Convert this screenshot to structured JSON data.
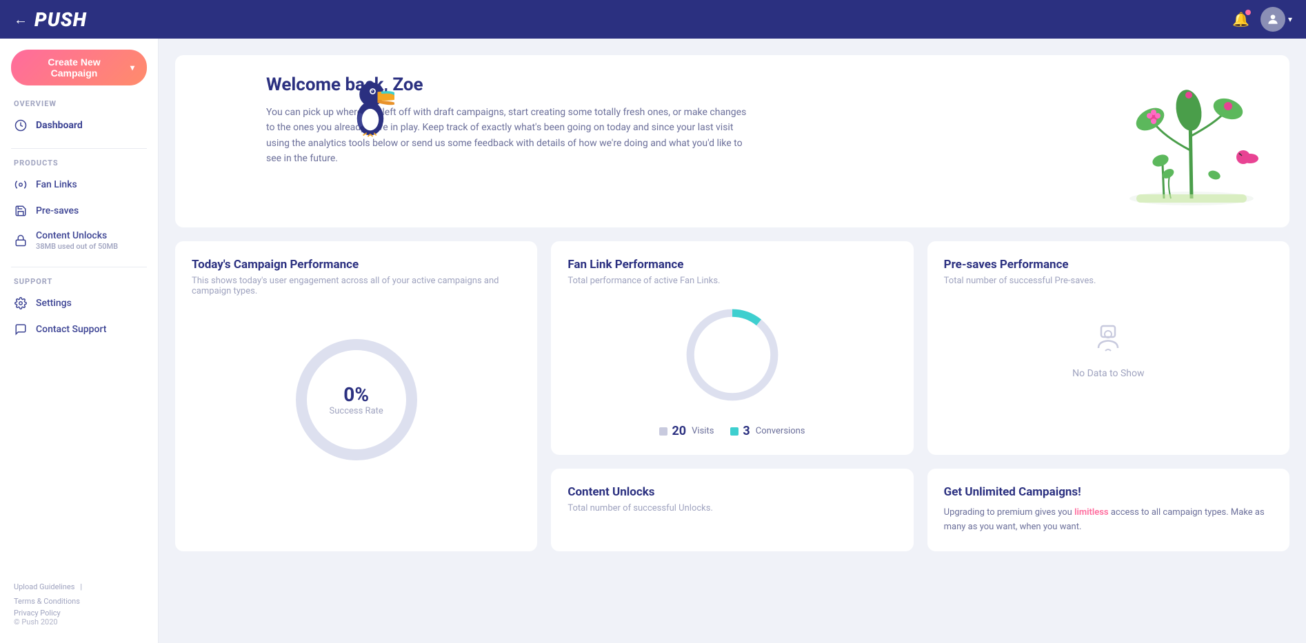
{
  "topnav": {
    "logo": "PUSH",
    "back_label": "←"
  },
  "sidebar": {
    "create_btn": "Create New Campaign",
    "create_caret": "▾",
    "overview_label": "OVERVIEW",
    "dashboard_label": "Dashboard",
    "products_label": "PRODUCTS",
    "fan_links_label": "Fan Links",
    "pre_saves_label": "Pre-saves",
    "content_unlocks_label": "Content Unlocks",
    "content_unlocks_sub": "38MB used out of 50MB",
    "support_label": "SUPPORT",
    "settings_label": "Settings",
    "contact_support_label": "Contact Support",
    "footer_upload": "Upload Guidelines",
    "footer_terms": "Terms & Conditions",
    "footer_privacy": "Privacy Policy",
    "footer_copy": "© Push 2020"
  },
  "welcome": {
    "title": "Welcome back, Zoe",
    "body": "You can pick up where you left off with draft campaigns, start creating some totally fresh ones, or make changes to the ones you already have in play. Keep track of exactly what's been going on today and since your last visit using the analytics tools below or send us some feedback with details of how we're doing and what you'd like to see in the future."
  },
  "today_campaign": {
    "title": "Today's Campaign Performance",
    "subtitle": "This shows today's user engagement across all of your active campaigns and campaign types.",
    "percent": "0%",
    "desc": "Success Rate",
    "donut_bg": "#dde0ef",
    "donut_fg": "#dde0ef"
  },
  "fan_link": {
    "title": "Fan Link Performance",
    "subtitle": "Total performance of active Fan Links.",
    "visits": 20,
    "conversions": 3,
    "visits_label": "Visits",
    "conversions_label": "Conversions",
    "donut_bg": "#dde0ef",
    "donut_fg": "#3ecfcf",
    "visits_color": "#c8cade",
    "conversions_color": "#3ecfcf"
  },
  "pre_saves": {
    "title": "Pre-saves Performance",
    "subtitle": "Total number of successful Pre-saves.",
    "no_data": "No Data to Show"
  },
  "content_unlocks": {
    "title": "Content Unlocks",
    "subtitle": "Total number of successful Unlocks."
  },
  "unlimited": {
    "title": "Get Unlimited Campaigns!",
    "body_part1": "Upgrading to premium gives you ",
    "body_highlight": "limitless",
    "body_part2": " access to all campaign types. Make as many as you want, when you want."
  }
}
